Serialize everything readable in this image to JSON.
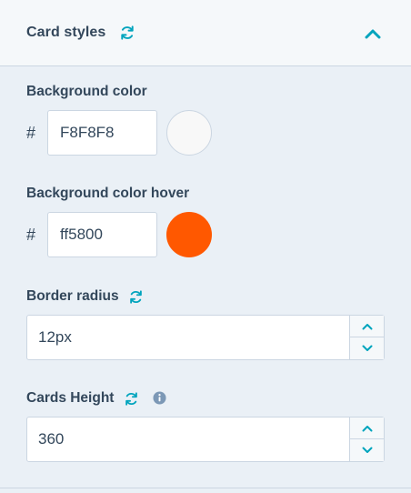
{
  "section": {
    "title": "Card styles",
    "reset_icon": "refresh-icon",
    "collapse_icon": "chevron-up-icon"
  },
  "background_color": {
    "label": "Background color",
    "hash": "#",
    "value": "F8F8F8",
    "swatch_color": "#F8F8F8"
  },
  "background_color_hover": {
    "label": "Background color hover",
    "hash": "#",
    "value": "ff5800",
    "swatch_color": "#ff5800"
  },
  "border_radius": {
    "label": "Border radius",
    "value": "12px",
    "reset_icon": "refresh-icon"
  },
  "cards_height": {
    "label": "Cards Height",
    "value": "360",
    "reset_icon": "refresh-icon",
    "info_icon": "info-icon"
  },
  "colors": {
    "accent": "#00a4bd",
    "text": "#33475b",
    "border": "#cbd6e2",
    "panel_bg": "#eaf0f6",
    "header_bg": "#f5f8fa",
    "info": "#7c98b6"
  }
}
